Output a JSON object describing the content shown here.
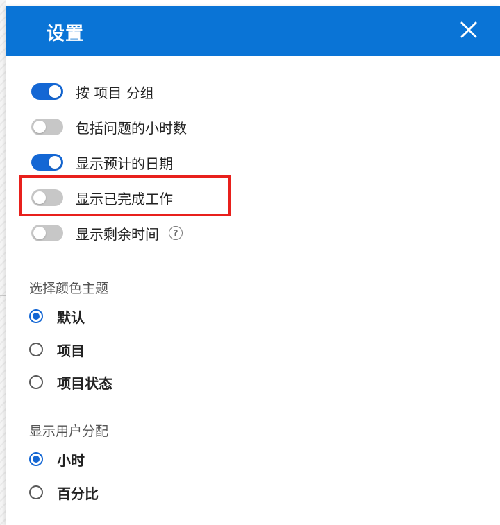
{
  "dialog": {
    "title": "设置",
    "close_icon": "close-icon"
  },
  "toggles": [
    {
      "label": "按 项目 分组",
      "on": true
    },
    {
      "label": "包括问题的小时数",
      "on": false
    },
    {
      "label": "显示预计的日期",
      "on": true
    },
    {
      "label": "显示已完成工作",
      "on": false
    },
    {
      "label": "显示剩余时间",
      "on": false,
      "help_icon": "help-icon",
      "help_glyph": "?"
    }
  ],
  "color_theme": {
    "title": "选择颜色主题",
    "options": [
      {
        "label": "默认",
        "selected": true
      },
      {
        "label": "项目",
        "selected": false
      },
      {
        "label": "项目状态",
        "selected": false
      }
    ]
  },
  "user_allocation": {
    "title": "显示用户分配",
    "options": [
      {
        "label": "小时",
        "selected": true
      },
      {
        "label": "百分比",
        "selected": false
      }
    ]
  },
  "colors": {
    "header": "#0a74d6",
    "toggle_on": "#1467d4",
    "toggle_off": "#c7c7c7",
    "highlight": "#e8201c"
  }
}
